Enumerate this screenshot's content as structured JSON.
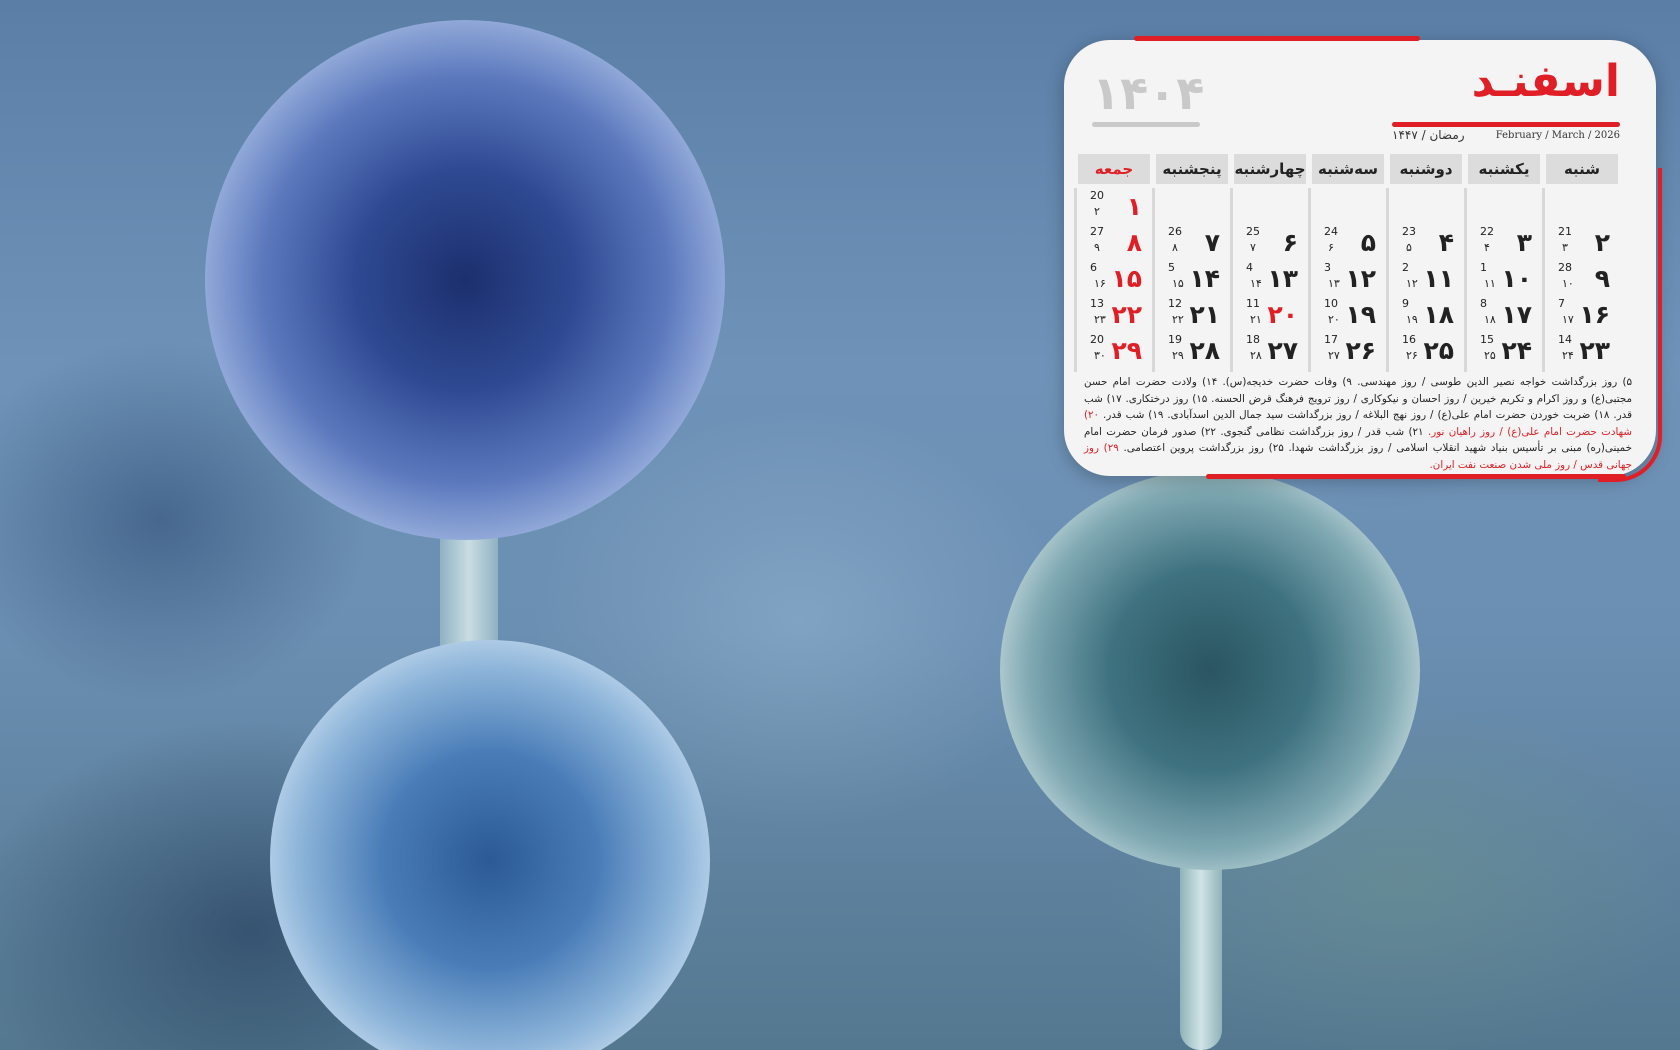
{
  "calendar": {
    "month_title": "اسفنـد",
    "year_title": "۱۴۰۴",
    "gregorian_months": "February / March / 2026",
    "hijri_months": "رمضان / ۱۴۴۷",
    "weekdays": [
      "شنبه",
      "یکشنبه",
      "دوشنبه",
      "سه‌شنبه",
      "چهارشنبه",
      "پنجشنبه",
      "جمعه"
    ],
    "rows": [
      [
        null,
        null,
        null,
        null,
        null,
        null,
        {
          "p": "۱",
          "g": "20",
          "h": "۲",
          "holiday": true
        }
      ],
      [
        {
          "p": "۲",
          "g": "21",
          "h": "۳"
        },
        {
          "p": "۳",
          "g": "22",
          "h": "۴"
        },
        {
          "p": "۴",
          "g": "23",
          "h": "۵"
        },
        {
          "p": "۵",
          "g": "24",
          "h": "۶"
        },
        {
          "p": "۶",
          "g": "25",
          "h": "۷"
        },
        {
          "p": "۷",
          "g": "26",
          "h": "۸"
        },
        {
          "p": "۸",
          "g": "27",
          "h": "۹",
          "holiday": true
        }
      ],
      [
        {
          "p": "۹",
          "g": "28",
          "h": "۱۰"
        },
        {
          "p": "۱۰",
          "g": "1",
          "h": "۱۱"
        },
        {
          "p": "۱۱",
          "g": "2",
          "h": "۱۲"
        },
        {
          "p": "۱۲",
          "g": "3",
          "h": "۱۳"
        },
        {
          "p": "۱۳",
          "g": "4",
          "h": "۱۴"
        },
        {
          "p": "۱۴",
          "g": "5",
          "h": "۱۵"
        },
        {
          "p": "۱۵",
          "g": "6",
          "h": "۱۶",
          "holiday": true
        }
      ],
      [
        {
          "p": "۱۶",
          "g": "7",
          "h": "۱۷"
        },
        {
          "p": "۱۷",
          "g": "8",
          "h": "۱۸"
        },
        {
          "p": "۱۸",
          "g": "9",
          "h": "۱۹"
        },
        {
          "p": "۱۹",
          "g": "10",
          "h": "۲۰"
        },
        {
          "p": "۲۰",
          "g": "11",
          "h": "۲۱",
          "holiday": true
        },
        {
          "p": "۲۱",
          "g": "12",
          "h": "۲۲"
        },
        {
          "p": "۲۲",
          "g": "13",
          "h": "۲۳",
          "holiday": true
        }
      ],
      [
        {
          "p": "۲۳",
          "g": "14",
          "h": "۲۴"
        },
        {
          "p": "۲۴",
          "g": "15",
          "h": "۲۵"
        },
        {
          "p": "۲۵",
          "g": "16",
          "h": "۲۶"
        },
        {
          "p": "۲۶",
          "g": "17",
          "h": "۲۷"
        },
        {
          "p": "۲۷",
          "g": "18",
          "h": "۲۸"
        },
        {
          "p": "۲۸",
          "g": "19",
          "h": "۲۹"
        },
        {
          "p": "۲۹",
          "g": "20",
          "h": "۳۰",
          "holiday": true
        }
      ]
    ],
    "events_line1": "۵) روز بزرگداشت خواجه نصیر الدین طوسی / روز مهندسی. ۹) وفات حضرت خدیجه(س). ۱۴) ولادت حضرت امام حسن مجتبی(ع) و روز اکرام",
    "events_line2": "و تکریم خیرین / روز احسان و نیکوکاری / روز ترویج فرهنگ قرض الحسنه. ۱۵) روز درختکاری. ۱۷) شب قدر. ۱۸) ضربت خوردن حضرت امام",
    "events_line3a": "علی(ع) / روز نهج البلاغه / روز بزرگداشت سید جمال الدین اسدآبادی. ۱۹) شب قدر. ",
    "events_line3_red": "۲۰) شهادت حضرت امام علی(ع) / روز راهیان نور.",
    "events_line3b": " ۲۱) شب",
    "events_line4": "قدر / روز بزرگداشت نظامی گنجوی. ۲۲) صدور فرمان حضرت امام خمینی(ره) مبنی بر تأسیس بنیاد شهید انقلاب اسلامی /  روز بزرگداشت",
    "events_line5a": "شهدا. ۲۵) روز بزرگداشت پروین اعتصامی. ",
    "events_line5_red": "۲۹) روز جهانی قدس / روز ملی شدن صنعت نفت ایران.",
    "accent_color": "#e01e25"
  }
}
